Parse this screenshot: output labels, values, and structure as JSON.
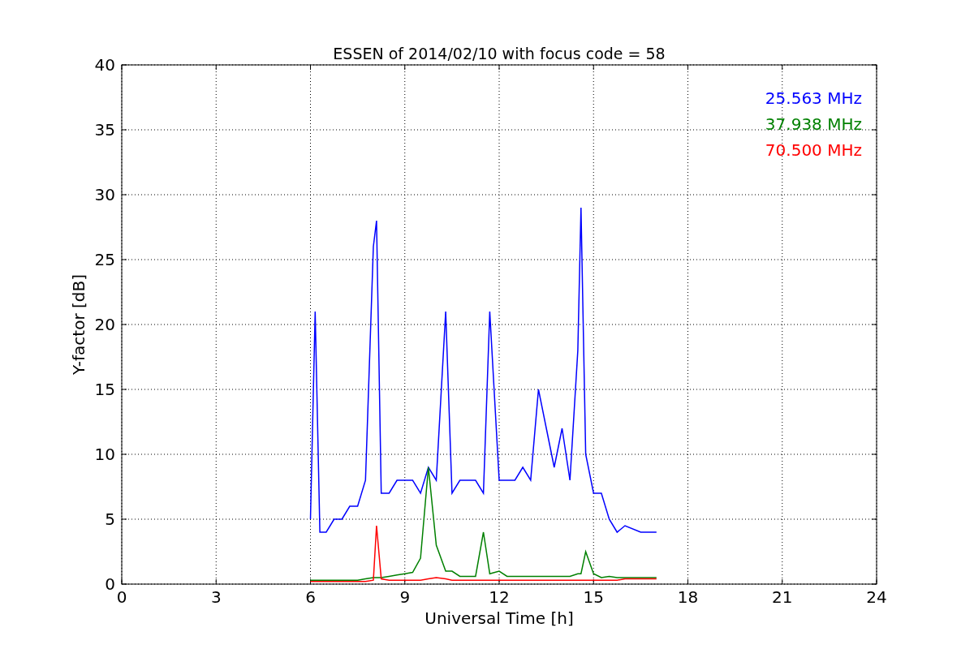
{
  "figure": {
    "chart_data": {
      "type": "line",
      "title": "ESSEN of 2014/02/10 with focus code = 58",
      "xlabel": "Universal Time [h]",
      "ylabel": "Y-factor [dB]",
      "x": [
        6,
        6.15,
        6.3,
        6.5,
        6.75,
        7,
        7.25,
        7.5,
        7.75,
        8,
        8.1,
        8.25,
        8.5,
        8.75,
        9,
        9.25,
        9.5,
        9.75,
        10,
        10.3,
        10.5,
        10.75,
        11,
        11.25,
        11.5,
        11.7,
        12,
        12.25,
        12.5,
        12.75,
        13,
        13.25,
        13.5,
        13.75,
        14,
        14.25,
        14.5,
        14.6,
        14.75,
        15,
        15.25,
        15.5,
        15.75,
        16,
        16.5,
        17
      ],
      "series": [
        {
          "name": "25.563 MHz",
          "color": "#0000ff",
          "values": [
            5,
            21,
            4,
            4,
            5,
            5,
            6,
            6,
            8,
            26,
            28,
            7,
            7,
            8,
            8,
            8,
            7,
            9,
            8,
            21,
            7,
            8,
            8,
            8,
            7,
            21,
            8,
            8,
            8,
            9,
            8,
            15,
            12,
            9,
            12,
            8,
            18,
            29,
            10,
            7,
            7,
            5,
            4,
            4.5,
            4,
            4
          ]
        },
        {
          "name": "37.938 MHz",
          "color": "#008000",
          "values": [
            0.3,
            0.3,
            0.3,
            0.3,
            0.3,
            0.3,
            0.3,
            0.3,
            0.4,
            0.5,
            0.5,
            0.5,
            0.6,
            0.7,
            0.8,
            0.9,
            2,
            9,
            3,
            1,
            1,
            0.6,
            0.6,
            0.6,
            4,
            0.8,
            1,
            0.6,
            0.6,
            0.6,
            0.6,
            0.6,
            0.6,
            0.6,
            0.6,
            0.6,
            0.8,
            0.8,
            2.5,
            0.8,
            0.5,
            0.6,
            0.5,
            0.5,
            0.5,
            0.5
          ]
        },
        {
          "name": "70.500 MHz",
          "color": "#ff0000",
          "values": [
            0.2,
            0.2,
            0.2,
            0.2,
            0.2,
            0.2,
            0.2,
            0.2,
            0.2,
            0.3,
            4.5,
            0.4,
            0.3,
            0.3,
            0.3,
            0.3,
            0.3,
            0.4,
            0.5,
            0.4,
            0.3,
            0.3,
            0.3,
            0.3,
            0.3,
            0.3,
            0.3,
            0.3,
            0.3,
            0.3,
            0.3,
            0.3,
            0.3,
            0.3,
            0.3,
            0.3,
            0.3,
            0.3,
            0.3,
            0.3,
            0.3,
            0.3,
            0.3,
            0.4,
            0.4,
            0.4
          ]
        }
      ],
      "xlim": [
        0,
        24
      ],
      "ylim": [
        0,
        40
      ],
      "xticks": [
        0,
        3,
        6,
        9,
        12,
        15,
        18,
        21,
        24
      ],
      "yticks": [
        0,
        5,
        10,
        15,
        20,
        25,
        30,
        35,
        40
      ],
      "grid": true
    }
  }
}
